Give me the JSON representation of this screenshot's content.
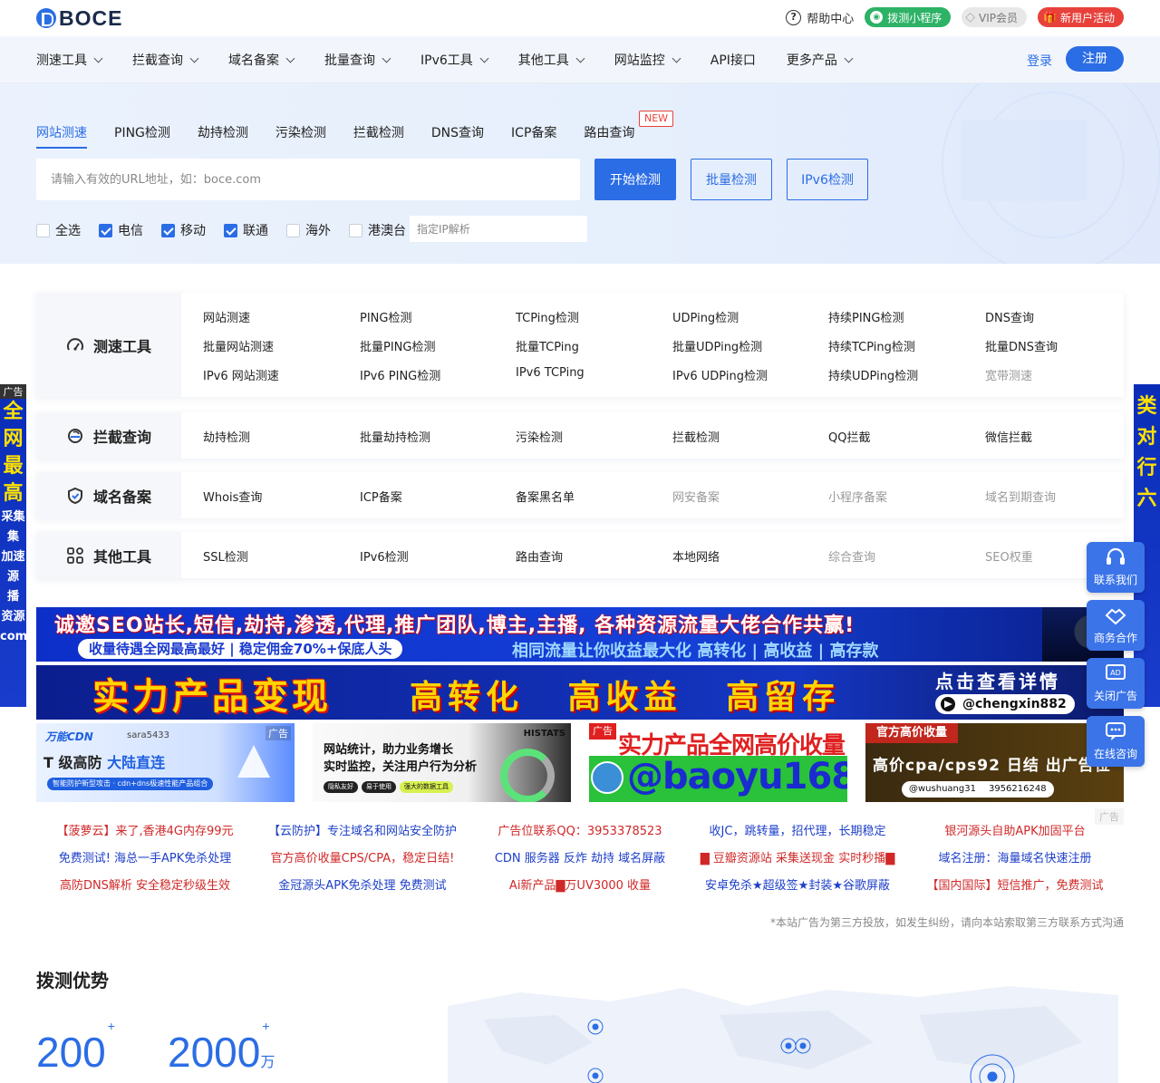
{
  "brand": {
    "logo_text": "BOCE"
  },
  "topbar": {
    "help": "帮助中心",
    "mini_program": "拨测小程序",
    "vip": "VIP会员",
    "new_user": "新用户活动"
  },
  "nav": {
    "items": [
      {
        "label": "测速工具",
        "dropdown": true
      },
      {
        "label": "拦截查询",
        "dropdown": true
      },
      {
        "label": "域名备案",
        "dropdown": true
      },
      {
        "label": "批量查询",
        "dropdown": true
      },
      {
        "label": "IPv6工具",
        "dropdown": true
      },
      {
        "label": "其他工具",
        "dropdown": true
      },
      {
        "label": "网站监控",
        "dropdown": true
      },
      {
        "label": "API接口",
        "dropdown": false
      },
      {
        "label": "更多产品",
        "dropdown": true
      }
    ],
    "login": "登录",
    "register": "注册"
  },
  "hero": {
    "tabs": [
      "网站测速",
      "PING检测",
      "劫持检测",
      "污染检测",
      "拦截检测",
      "DNS查询",
      "ICP备案",
      "路由查询"
    ],
    "new_badge": "NEW",
    "url_placeholder": "请输入有效的URL地址，如：boce.com",
    "start": "开始检测",
    "batch": "批量检测",
    "ipv6": "IPv6检测",
    "options": [
      {
        "label": "全选",
        "checked": false
      },
      {
        "label": "电信",
        "checked": true
      },
      {
        "label": "移动",
        "checked": true
      },
      {
        "label": "联通",
        "checked": true
      },
      {
        "label": "海外",
        "checked": false
      },
      {
        "label": "港澳台",
        "checked": false
      }
    ],
    "ip_placeholder": "指定IP解析"
  },
  "panels": [
    {
      "title": "测速工具",
      "icon": "speedometer-icon",
      "rows": [
        [
          "网站测速",
          "PING检测",
          "TCPing检测",
          "UDPing检测",
          "持续PING检测",
          "DNS查询"
        ],
        [
          "批量网站测速",
          "批量PING检测",
          "批量TCPing",
          "批量UDPing检测",
          "持续TCPing检测",
          "批量DNS查询"
        ],
        [
          "IPv6 网站测速",
          "IPv6 PING检测",
          "IPv6 TCPing",
          "IPv6 UDPing检测",
          "持续UDPing检测",
          "宽带测速"
        ]
      ],
      "muted": [
        "宽带测速"
      ]
    },
    {
      "title": "拦截查询",
      "icon": "shield-scan-icon",
      "rows": [
        [
          "劫持检测",
          "批量劫持检测",
          "污染检测",
          "拦截检测",
          "QQ拦截",
          "微信拦截"
        ]
      ],
      "muted": []
    },
    {
      "title": "域名备案",
      "icon": "badge-check-icon",
      "rows": [
        [
          "Whois查询",
          "ICP备案",
          "备案黑名单",
          "网安备案",
          "小程序备案",
          "域名到期查询"
        ]
      ],
      "muted": [
        "网安备案",
        "小程序备案",
        "域名到期查询"
      ]
    },
    {
      "title": "其他工具",
      "icon": "grid-icon",
      "rows": [
        [
          "SSL检测",
          "IPv6检测",
          "路由查询",
          "本地网络",
          "综合查询",
          "SEO权重"
        ]
      ],
      "muted": [
        "综合查询",
        "SEO权重"
      ]
    }
  ],
  "ads": {
    "banner1_top": "诚邀SEO站长,短信,劫持,渗透,代理,推广团队,博主,主播, 各种资源流量大佬合作共赢!",
    "banner1_left": "收量待遇全网最高最好 | 稳定佣金70%+保底人头",
    "banner1_right": "相同流量让你收益最大化 高转化 | 高收益 | 高存款",
    "banner2_main": "实力产品变现",
    "banner2_words": "高转化 高收益 高留存",
    "banner2_cta": "点击查看详情",
    "banner2_handle": "@chengxin882",
    "tag": "广告",
    "tile1_brand": "万能CDN",
    "tile1_user": "sara5433",
    "tile1_main_a": "T 级高防",
    "tile1_main_b": "大陆直连",
    "tile1_sub": "智能防护新型攻击 · cdn+dns极速性能产品组合",
    "tile2_line1": "网站统计，助力业务增长",
    "tile2_line2": "实时监控，关注用户行为分析",
    "tile2_chips": [
      "隐私友好",
      "易于使用",
      "强大的数据工具"
    ],
    "tile2_brand": "HISTATS",
    "tile3_title": "实力产品全网高价收量",
    "tile3_handle": "@baoyu168",
    "tile4_head": "官方高价收量",
    "tile4_main": "高价cpa/cps92 日结 出广告位",
    "tile4_tg": "@wushuang31",
    "tile4_qq": "3956216248",
    "text_ads": [
      {
        "text": "【菠萝云】来了,香港4G内存99元",
        "color": "r"
      },
      {
        "text": "【云防护】专注域名和网站安全防护",
        "color": "b"
      },
      {
        "text": "广告位联系QQ：3953378523",
        "color": "r"
      },
      {
        "text": "收JC，跳转量，招代理，长期稳定",
        "color": "b"
      },
      {
        "text": "银河源头自助APK加固平台",
        "color": "r"
      },
      {
        "text": "免费测试! 海总一手APK免杀处理",
        "color": "b"
      },
      {
        "text": "官方高价收量CPS/CPA，稳定日结!",
        "color": "r"
      },
      {
        "text": "CDN 服务器 反炸 劫持 域名屏蔽",
        "color": "b"
      },
      {
        "text": "▇ 豆瓣资源站 采集送现金 实时秒播▇",
        "color": "r"
      },
      {
        "text": "域名注册：海量域名快速注册",
        "color": "b"
      },
      {
        "text": "高防DNS解析 安全稳定秒级生效",
        "color": "r"
      },
      {
        "text": "金冠源头APK免杀处理 免费测试",
        "color": "b"
      },
      {
        "text": "Ai新产品▇万UV3000 收量",
        "color": "r"
      },
      {
        "text": "安卓免杀★超级签★封装★谷歌屏蔽",
        "color": "b"
      },
      {
        "text": "【国内国际】短信推广，免费测试",
        "color": "r"
      }
    ],
    "disclaimer": "*本站广告为第三方投放，如发生纠纷，请向本站索取第三方联系方式沟通",
    "side_left_tag": "广告",
    "side_left_text": "全网最高",
    "side_left_extra": "采集 集 加速 源 播 资源 com",
    "side_right_text": "类 对 行 六"
  },
  "float": {
    "contact": "联系我们",
    "business": "商务合作",
    "close_ad": "关闭广告",
    "consult": "在线咨询"
  },
  "advantage": {
    "title": "拨测优势",
    "stat1_value": "200",
    "stat1_sup": "+",
    "stat2_value": "2000",
    "stat2_sup": "+",
    "stat2_unit": "万"
  }
}
